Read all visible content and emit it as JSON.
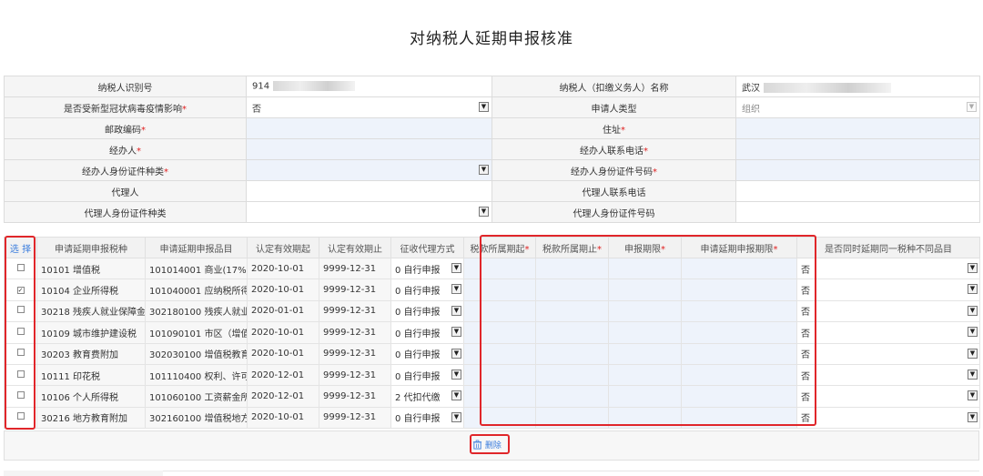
{
  "page": {
    "title": "对纳税人延期申报核准"
  },
  "info": {
    "rows": [
      {
        "l1": "纳税人识别号",
        "r1": false,
        "v1": "914",
        "blur1": true,
        "dd1": false,
        "t1": "val",
        "l2": "纳税人（扣缴义务人）名称",
        "r2": false,
        "v2": "武汉",
        "blur2": true,
        "dd2": false,
        "t2": "val"
      },
      {
        "l1": "是否受新型冠状病毒疫情影响",
        "r1": true,
        "v1": "否",
        "dd1": true,
        "t1": "val",
        "l2": "申请人类型",
        "r2": false,
        "v2": "组织",
        "dd2": true,
        "t2": "grey"
      },
      {
        "l1": "邮政编码",
        "r1": true,
        "v1": "",
        "dd1": false,
        "t1": "inp",
        "l2": "住址",
        "r2": true,
        "v2": "",
        "dd2": false,
        "t2": "inp"
      },
      {
        "l1": "经办人",
        "r1": true,
        "v1": "",
        "dd1": false,
        "t1": "inp",
        "l2": "经办人联系电话",
        "r2": true,
        "v2": "",
        "dd2": false,
        "t2": "inp"
      },
      {
        "l1": "经办人身份证件种类",
        "r1": true,
        "v1": "",
        "dd1": true,
        "t1": "inp",
        "l2": "经办人身份证件号码",
        "r2": true,
        "v2": "",
        "dd2": false,
        "t2": "inp"
      },
      {
        "l1": "代理人",
        "r1": false,
        "v1": "",
        "dd1": false,
        "t1": "val",
        "l2": "代理人联系电话",
        "r2": false,
        "v2": "",
        "dd2": false,
        "t2": "val"
      },
      {
        "l1": "代理人身份证件种类",
        "r1": false,
        "v1": "",
        "dd1": true,
        "t1": "val",
        "l2": "代理人身份证件号码",
        "r2": false,
        "v2": "",
        "dd2": false,
        "t2": "val"
      }
    ]
  },
  "grid": {
    "headers": [
      {
        "label": "选 择",
        "req": false
      },
      {
        "label": "申请延期申报税种",
        "req": false
      },
      {
        "label": "申请延期申报品目",
        "req": false
      },
      {
        "label": "认定有效期起",
        "req": false
      },
      {
        "label": "认定有效期止",
        "req": false
      },
      {
        "label": "征收代理方式",
        "req": false
      },
      {
        "label": "税款所属期起",
        "req": true
      },
      {
        "label": "税款所属期止",
        "req": true
      },
      {
        "label": "申报期限",
        "req": true
      },
      {
        "label": "申请延期申报期限",
        "req": true
      },
      {
        "label": "是否同时延期同一税种不同品目",
        "req": false
      }
    ],
    "rows": [
      {
        "checked": false,
        "tax": "10101 增值税",
        "item": "101014001 商业(17%、16%",
        "start": "2020-10-01",
        "end": "9999-12-31",
        "mode": "0 自行申报",
        "same": "否"
      },
      {
        "checked": true,
        "tax": "10104 企业所得税",
        "item": "101040001 应纳税所得额",
        "start": "2020-10-01",
        "end": "9999-12-31",
        "mode": "0 自行申报",
        "same": "否"
      },
      {
        "checked": false,
        "tax": "30218 残疾人就业保障金",
        "item": "302180100 残疾人就业保障",
        "start": "2020-01-01",
        "end": "9999-12-31",
        "mode": "0 自行申报",
        "same": "否"
      },
      {
        "checked": false,
        "tax": "10109 城市维护建设税",
        "item": "101090101 市区（增值税附",
        "start": "2020-10-01",
        "end": "9999-12-31",
        "mode": "0 自行申报",
        "same": "否"
      },
      {
        "checked": false,
        "tax": "30203 教育费附加",
        "item": "302030100 增值税教育费附",
        "start": "2020-10-01",
        "end": "9999-12-31",
        "mode": "0 自行申报",
        "same": "否"
      },
      {
        "checked": false,
        "tax": "10111 印花税",
        "item": "101110400 权利、许可证照",
        "start": "2020-12-01",
        "end": "9999-12-31",
        "mode": "0 自行申报",
        "same": "否"
      },
      {
        "checked": false,
        "tax": "10106 个人所得税",
        "item": "101060100 工资薪金所得",
        "start": "2020-12-01",
        "end": "9999-12-31",
        "mode": "2 代扣代缴",
        "same": "否"
      },
      {
        "checked": false,
        "tax": "30216 地方教育附加",
        "item": "302160100 增值税地方教育",
        "start": "2020-10-01",
        "end": "9999-12-31",
        "mode": "0 自行申报",
        "same": "否"
      }
    ]
  },
  "toolbar": {
    "delete_label": "删除"
  },
  "icons": {
    "dropdown": "dropdown-arrow-icon",
    "trash": "trash-icon",
    "checkbox": "checkbox-icon"
  },
  "colors": {
    "highlight": "#e0262a",
    "required": "#e02020",
    "input_bg": "#eef3fb",
    "link": "#3b7ddd"
  }
}
